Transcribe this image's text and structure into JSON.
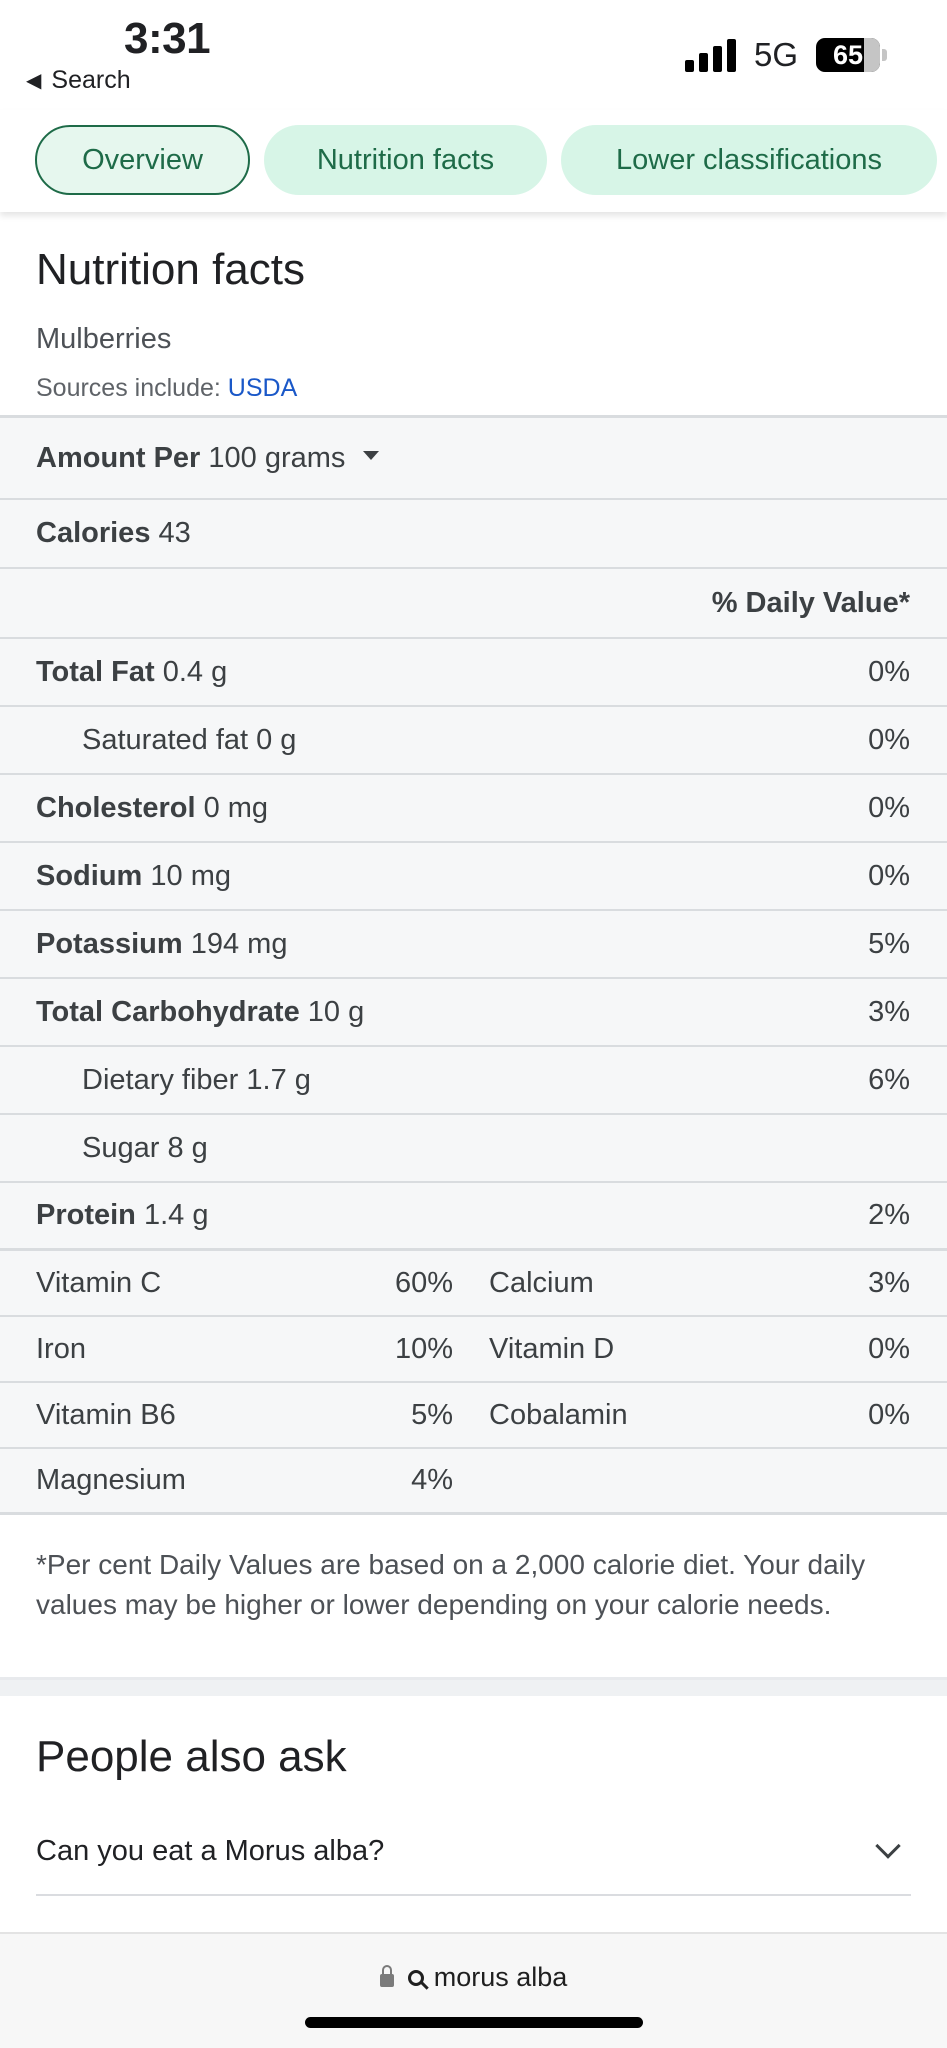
{
  "status_bar": {
    "time": "3:31",
    "back_label": "Search",
    "network": "5G",
    "battery": "65"
  },
  "chips": [
    {
      "label": "Overview",
      "active": true
    },
    {
      "label": "Nutrition facts",
      "active": false
    },
    {
      "label": "Lower classifications",
      "active": false
    }
  ],
  "nutrition": {
    "title": "Nutrition facts",
    "food": "Mulberries",
    "source_prefix": "Sources include:",
    "source_link": "USDA",
    "amount_label": "Amount Per",
    "amount_value": "100 grams",
    "calories_label": "Calories",
    "calories_value": "43",
    "daily_value_header": "% Daily Value*",
    "nutrients": [
      {
        "name": "Total Fat",
        "amount": "0.4 g",
        "dv": "0%",
        "bold": true
      },
      {
        "name": "Saturated fat",
        "amount": "0 g",
        "dv": "0%",
        "bold": false
      },
      {
        "name": "Cholesterol",
        "amount": "0 mg",
        "dv": "0%",
        "bold": true
      },
      {
        "name": "Sodium",
        "amount": "10 mg",
        "dv": "0%",
        "bold": true
      },
      {
        "name": "Potassium",
        "amount": "194 mg",
        "dv": "5%",
        "bold": true
      },
      {
        "name": "Total Carbohydrate",
        "amount": "10 g",
        "dv": "3%",
        "bold": true
      },
      {
        "name": "Dietary fiber",
        "amount": "1.7 g",
        "dv": "6%",
        "bold": false
      },
      {
        "name": "Sugar",
        "amount": "8 g",
        "dv": "",
        "bold": false
      },
      {
        "name": "Protein",
        "amount": "1.4 g",
        "dv": "2%",
        "bold": true
      }
    ],
    "vitamins": [
      [
        {
          "name": "Vitamin C",
          "dv": "60%"
        },
        {
          "name": "Calcium",
          "dv": "3%"
        }
      ],
      [
        {
          "name": "Iron",
          "dv": "10%"
        },
        {
          "name": "Vitamin D",
          "dv": "0%"
        }
      ],
      [
        {
          "name": "Vitamin B6",
          "dv": "5%"
        },
        {
          "name": "Cobalamin",
          "dv": "0%"
        }
      ],
      [
        {
          "name": "Magnesium",
          "dv": "4%"
        },
        {
          "name": "",
          "dv": ""
        }
      ]
    ],
    "footnote": "*Per cent Daily Values are based on a 2,000 calorie diet. Your daily values may be higher or lower depending on your calorie needs."
  },
  "people_also_ask": {
    "title": "People also ask",
    "questions": [
      "Can you eat a Morus alba?"
    ]
  },
  "url_bar": {
    "query": "morus alba"
  },
  "icons": {
    "back": "back-triangle-icon",
    "signal": "cellular-signal-icon",
    "battery": "battery-icon",
    "dropdown": "caret-down-icon",
    "expand": "chevron-down-icon",
    "lock": "lock-icon",
    "search": "search-icon"
  },
  "colors": {
    "chip_bg": "#d7f5e7",
    "chip_text": "#1e6b48",
    "link": "#1a58c8",
    "table_bg": "#f6f7f8"
  }
}
